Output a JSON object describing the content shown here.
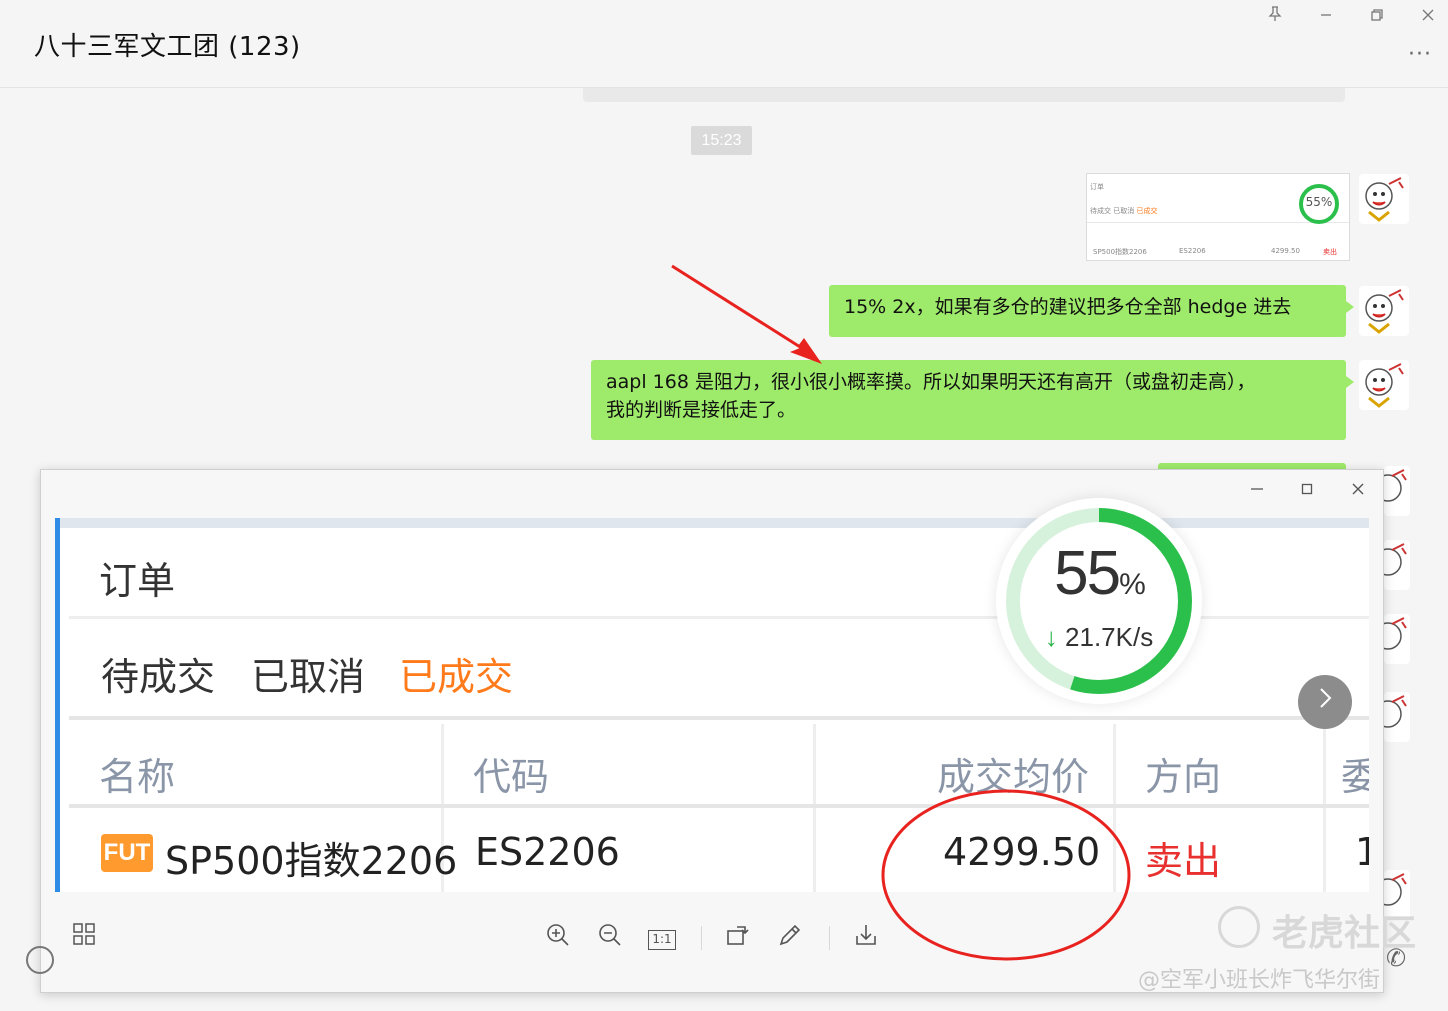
{
  "chat": {
    "title": "八十三军文工团 (123)",
    "window_controls": [
      "pin-icon",
      "minimize-icon",
      "restore-icon",
      "close-icon"
    ],
    "more_label": "···",
    "timestamp": "15:23",
    "thumbnail": {
      "percent": "55%",
      "row_name": "SP500指数2206",
      "row_code": "ES2206",
      "row_price": "4299.50",
      "row_dir": "卖出"
    },
    "messages": [
      {
        "text": "15% 2x，如果有多仓的建议把多仓全部 hedge 进去"
      },
      {
        "line1": "aapl 168 是阻力，很小很小概率摸。所以如果明天还有高开（或盘初走高），",
        "line2": "我的判断是接低走了。"
      }
    ],
    "bubble_color": "#9eea6a"
  },
  "viewer": {
    "controls": [
      "minimize-icon",
      "maximize-icon",
      "close-icon"
    ],
    "screenshot": {
      "title": "订单",
      "tabs": [
        {
          "label": "待成交",
          "active": false
        },
        {
          "label": "已取消",
          "active": false
        },
        {
          "label": "已成交",
          "active": true
        }
      ],
      "columns": [
        "名称",
        "代码",
        "成交均价",
        "方向",
        "委"
      ],
      "row": {
        "badge": "FUT",
        "name": "SP500指数2206",
        "code": "ES2206",
        "avg_price": "4299.50",
        "direction": "卖出",
        "extra": "1"
      },
      "accent_color": "#ff7a1a",
      "sell_color": "#e8302f"
    },
    "speed_widget": {
      "percent": "55",
      "percent_unit": "%",
      "progress": 0.55,
      "rate": "21.7K/s",
      "ring_color": "#2bc04c"
    },
    "toolbar": [
      "grid-icon",
      "zoom-in-icon",
      "zoom-out-icon",
      "actual-size-icon",
      "rotate-icon",
      "edit-icon",
      "download-icon"
    ],
    "actual_size_label": "1:1"
  },
  "watermark": {
    "brand": "老虎社区",
    "author": "@空军小班长炸飞华尔街"
  },
  "annotation_color": "#e8231f"
}
